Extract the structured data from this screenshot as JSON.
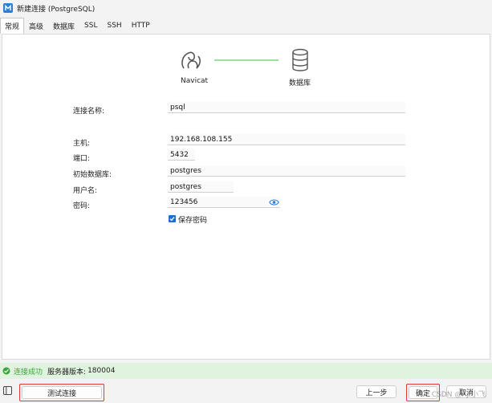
{
  "window": {
    "title": "新建连接 (PostgreSQL)"
  },
  "tabs": [
    {
      "label": "常规",
      "active": true
    },
    {
      "label": "高级"
    },
    {
      "label": "数据库"
    },
    {
      "label": "SSL"
    },
    {
      "label": "SSH"
    },
    {
      "label": "HTTP"
    }
  ],
  "diagram": {
    "left_label": "Navicat",
    "right_label": "数据库",
    "line_color": "#7bd67b"
  },
  "form": {
    "connection_name_label": "连接名称:",
    "connection_name": "psql",
    "host_label": "主机:",
    "host": "192.168.108.155",
    "port_label": "端口:",
    "port": "5432",
    "initial_db_label": "初始数据库:",
    "initial_db": "postgres",
    "username_label": "用户名:",
    "username": "postgres",
    "password_label": "密码:",
    "password": "123456",
    "save_password_label": "保存密码",
    "save_password_checked": true
  },
  "status": {
    "result": "连接成功",
    "server_version_label": "服务器版本:",
    "server_version": "180004",
    "color": "#3aa63a"
  },
  "buttons": {
    "test_connection": "测试连接",
    "previous": "上一步",
    "ok": "确定",
    "cancel": "取消"
  },
  "watermark": "CSDN @AJ.小飞"
}
